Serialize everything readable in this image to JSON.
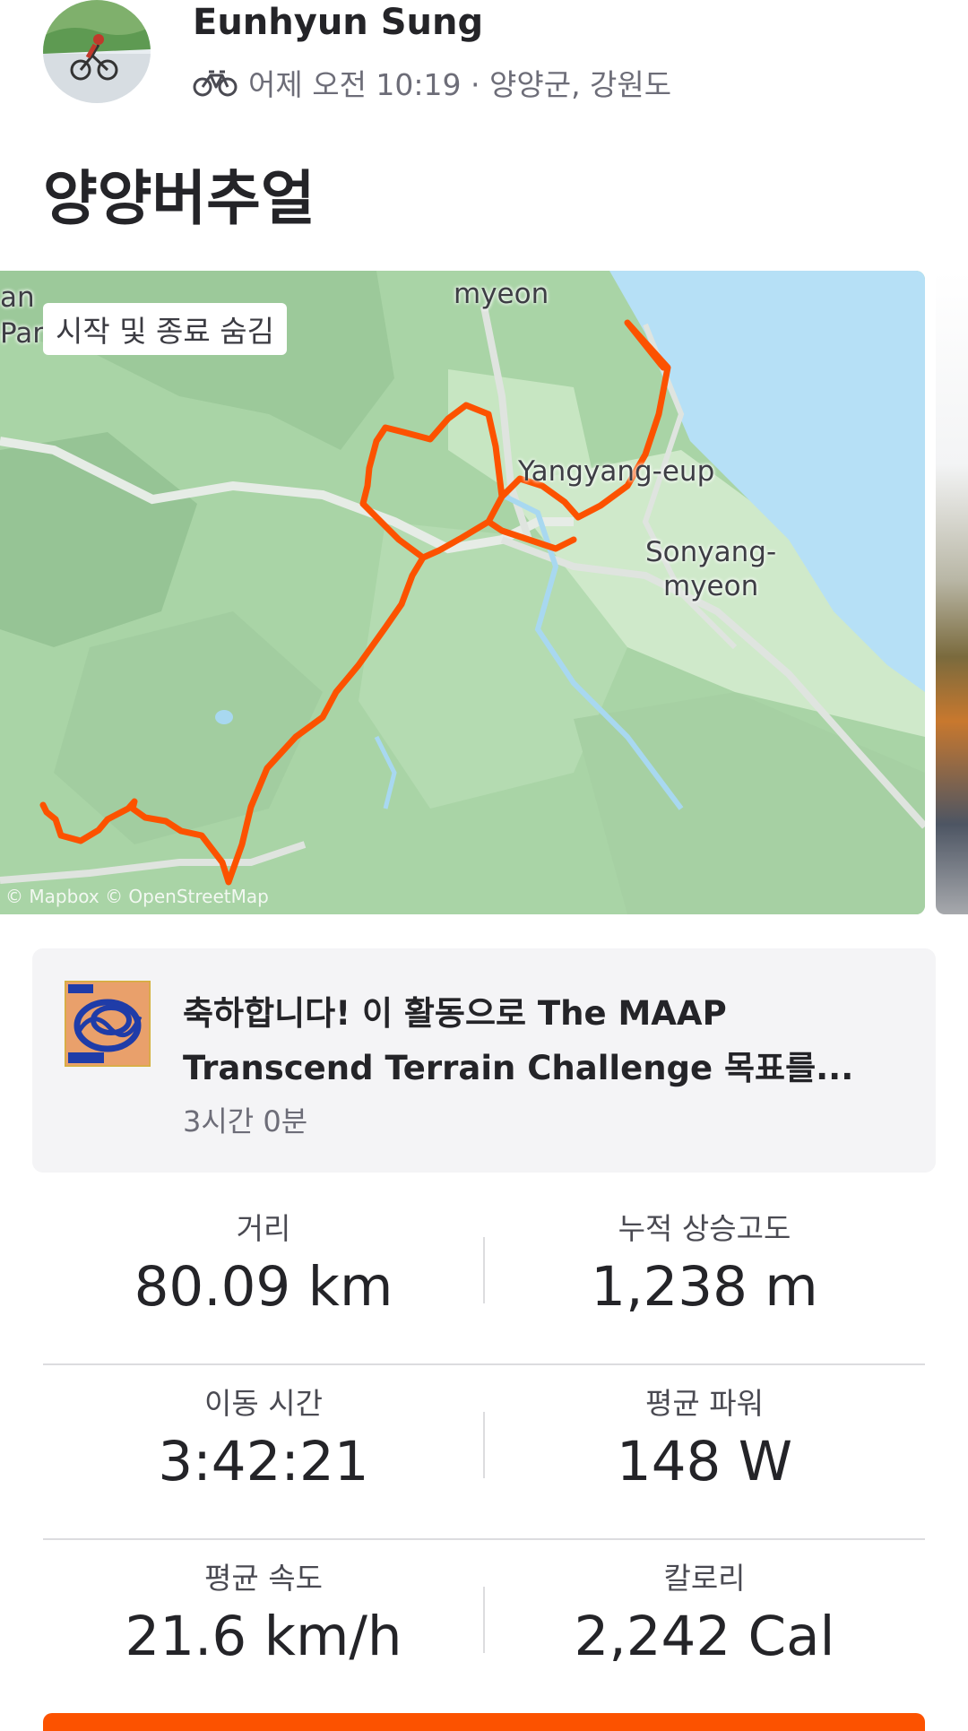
{
  "header": {
    "athlete_name": "Eunhyun Sung",
    "activity_type_icon": "bicycle-icon",
    "time_location": "어제 오전 10:19 · 양양군, 강원도",
    "title": "양양버추얼"
  },
  "map": {
    "toggle_label": "시작 및 종료 숨김",
    "labels": {
      "myeon_top": "myeon",
      "yangyang": "Yangyang-eup",
      "sonyang_line1": "Sonyang-",
      "sonyang_line2": "myeon",
      "an": "an",
      "park": "Park"
    },
    "credit": "© Mapbox © OpenStreetMap",
    "route_color": "#fc5200"
  },
  "achievement": {
    "badge_icon": "maap-terrain-badge-icon",
    "text": "축하합니다! 이 활동으로 The MAAP Transcend Terrain Challenge 목표를...",
    "subtitle": "3시간 0분"
  },
  "stats": [
    {
      "left": {
        "label": "거리",
        "value": "80.09 km"
      },
      "right": {
        "label": "누적 상승고도",
        "value": "1,238 m"
      }
    },
    {
      "left": {
        "label": "이동 시간",
        "value": "3:42:21"
      },
      "right": {
        "label": "평균 파워",
        "value": "148 W"
      }
    },
    {
      "left": {
        "label": "평균 속도",
        "value": "21.6 km/h"
      },
      "right": {
        "label": "칼로리",
        "value": "2,242 Cal"
      }
    }
  ],
  "colors": {
    "accent": "#fc5200",
    "text": "#242428",
    "muted": "#6d6d78"
  }
}
